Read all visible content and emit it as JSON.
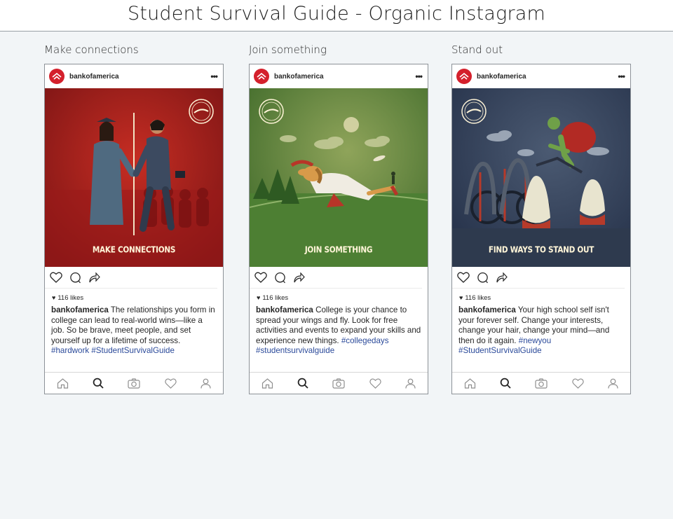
{
  "page": {
    "title": "Student Survival Guide - Organic Instagram"
  },
  "brand": {
    "red": "#d4202c",
    "hashtag_color": "#2b4a9a"
  },
  "posts": [
    {
      "heading": "Make connections",
      "username": "bankofamerica",
      "image_caption": "MAKE CONNECTIONS",
      "likes": "116 likes",
      "caption_user": "bankofamerica",
      "caption_text": " The relationships you form in college can lead to real-world wins—like a job. So be brave, meet people, and set yourself up for a lifetime of success.",
      "hashtags": "#hardwork #StudentSurvivalGuide",
      "theme_color": "#a51b1b"
    },
    {
      "heading": "Join something",
      "username": "bankofamerica",
      "image_caption": "JOIN SOMETHING",
      "likes": "116 likes",
      "caption_user": "bankofamerica",
      "caption_text": " College is your chance to spread your wings and fly. Look for free activities and events to expand your skills and experience new things.",
      "hashtags": "#collegedays #studentsurvivalguide",
      "theme_color": "#4f7a35"
    },
    {
      "heading": "Stand out",
      "username": "bankofamerica",
      "image_caption": "FIND WAYS TO STAND OUT",
      "likes": "116 likes",
      "caption_user": "bankofamerica",
      "caption_text": " Your high school self isn't your forever self. Change your interests, change your hair, change your mind—and then do it again.",
      "hashtags": "#newyou #StudentSurvivalGuide",
      "theme_color": "#34425a"
    }
  ],
  "icons": {
    "post_actions": [
      "heart-icon",
      "comment-icon",
      "share-icon"
    ],
    "bottom_nav": [
      "home-icon",
      "search-icon",
      "camera-icon",
      "heart-icon",
      "profile-icon"
    ]
  }
}
